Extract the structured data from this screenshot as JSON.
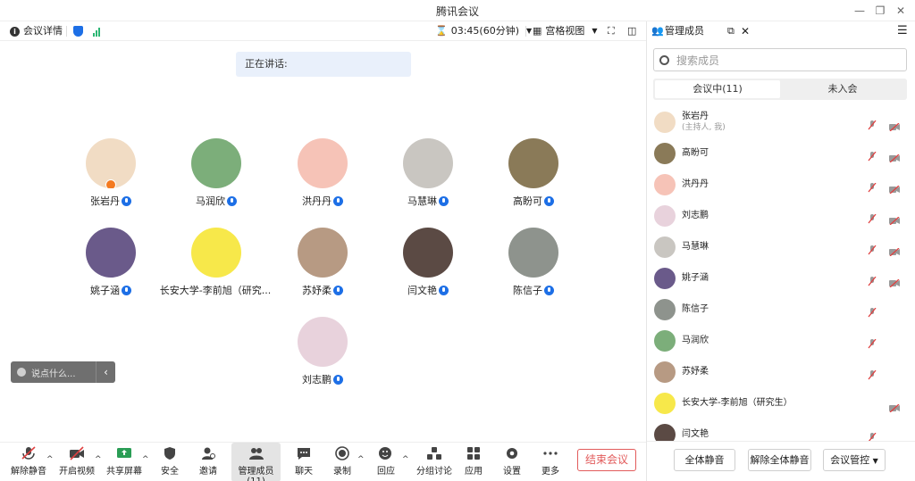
{
  "window": {
    "title": "腾讯会议"
  },
  "toolbar": {
    "meeting_info": "会议详情",
    "timer": "03:45(60分钟)",
    "view_mode": "宫格视图",
    "members_label": "管理成员"
  },
  "stage": {
    "speaking": "正在讲话:",
    "chat_placeholder": "说点什么..."
  },
  "participants": [
    {
      "name": "张岩丹",
      "color": "#f1dcc4",
      "host": true
    },
    {
      "name": "马润欣",
      "color": "#7cae7a"
    },
    {
      "name": "洪丹丹",
      "color": "#f6c3b7"
    },
    {
      "name": "马慧琳",
      "color": "#c9c6c1"
    },
    {
      "name": "高盼可",
      "color": "#8a7a58"
    },
    {
      "name": "姚子涵",
      "color": "#6a5a8a"
    },
    {
      "name": "长安大学-李前旭（研究...",
      "color": "#f7e84a"
    },
    {
      "name": "苏妤柔",
      "color": "#b79a83"
    },
    {
      "name": "闫文艳",
      "color": "#5b4a44"
    },
    {
      "name": "陈信子",
      "color": "#8e938d"
    },
    {
      "name": "刘志鹏",
      "color": "#e8d2dc"
    }
  ],
  "bottombar": {
    "unmute": "解除静音",
    "video": "开启视频",
    "share": "共享屏幕",
    "security": "安全",
    "invite": "邀请",
    "members": "管理成员(11)",
    "chat": "聊天",
    "record": "录制",
    "react": "回应",
    "breakout": "分组讨论",
    "apps": "应用",
    "settings": "设置",
    "more": "更多",
    "end": "结束会议"
  },
  "panel": {
    "search_placeholder": "搜索成员",
    "tab_in": "会议中(11)",
    "tab_out": "未入会",
    "mute_all": "全体静音",
    "unmute_all": "解除全体静音",
    "control": "会议管控"
  },
  "members": [
    {
      "name": "张岩丹",
      "sub": "(主持人, 我)",
      "color": "#f1dcc4",
      "cam": true
    },
    {
      "name": "高盼可",
      "color": "#8a7a58",
      "cam": true
    },
    {
      "name": "洪丹丹",
      "color": "#f6c3b7",
      "cam": true
    },
    {
      "name": "刘志鹏",
      "color": "#e8d2dc",
      "cam": true
    },
    {
      "name": "马慧琳",
      "color": "#c9c6c1",
      "cam": true
    },
    {
      "name": "姚子涵",
      "color": "#6a5a8a",
      "cam": true
    },
    {
      "name": "陈信子",
      "color": "#8e938d",
      "cam": false
    },
    {
      "name": "马润欣",
      "color": "#7cae7a",
      "cam": false
    },
    {
      "name": "苏妤柔",
      "color": "#b79a83",
      "cam": false
    },
    {
      "name": "长安大学-李前旭（研究生）",
      "color": "#f7e84a",
      "cam": true,
      "nomic": true
    },
    {
      "name": "闫文艳",
      "color": "#5b4a44",
      "cam": false
    }
  ]
}
